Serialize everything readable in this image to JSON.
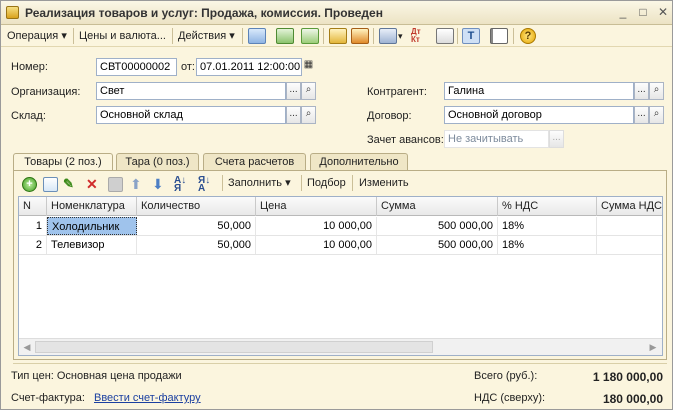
{
  "window": {
    "title": "Реализация товаров и услуг: Продажа, комиссия. Проведен",
    "controls": [
      "_",
      "□",
      "✕"
    ]
  },
  "toolbar": {
    "operation": "Операция",
    "prices": "Цены и валюта...",
    "actions": "Действия"
  },
  "form": {
    "number_label": "Номер:",
    "number_value": "СВТ00000002",
    "date_label": "от:",
    "date_value": "07.01.2011 12:00:00",
    "org_label": "Организация:",
    "org_value": "Свет",
    "warehouse_label": "Склад:",
    "warehouse_value": "Основной склад",
    "counterparty_label": "Контрагент:",
    "counterparty_value": "Галина",
    "contract_label": "Договор:",
    "contract_value": "Основной договор",
    "advance_label": "Зачет авансов:",
    "advance_value": "Не зачитывать",
    "btn_ellipsis": "...",
    "btn_search": "🔍"
  },
  "tabs": [
    {
      "label": "Товары (2 поз.)"
    },
    {
      "label": "Тара (0 поз.)"
    },
    {
      "label": "Счета расчетов"
    },
    {
      "label": "Дополнительно"
    }
  ],
  "panel_toolbar": {
    "fill": "Заполнить",
    "select": "Подбор",
    "change": "Изменить"
  },
  "table": {
    "columns": [
      "N",
      "Номенклатура",
      "Количество",
      "Цена",
      "Сумма",
      "% НДС",
      "Сумма НДС"
    ],
    "rows": [
      [
        "1",
        "Холодильник",
        "50,000",
        "10 000,00",
        "500 000,00",
        "18%",
        ""
      ],
      [
        "2",
        "Телевизор",
        "50,000",
        "10 000,00",
        "500 000,00",
        "18%",
        ""
      ]
    ]
  },
  "footer": {
    "price_type": "Тип цен: Основная цена продажи",
    "invoice_label": "Счет-фактура:",
    "invoice_link": "Ввести счет-фактуру",
    "total_label": "Всего (руб.):",
    "total_value": "1 180 000,00",
    "vat_label": "НДС (сверху):",
    "vat_value": "180 000,00"
  }
}
